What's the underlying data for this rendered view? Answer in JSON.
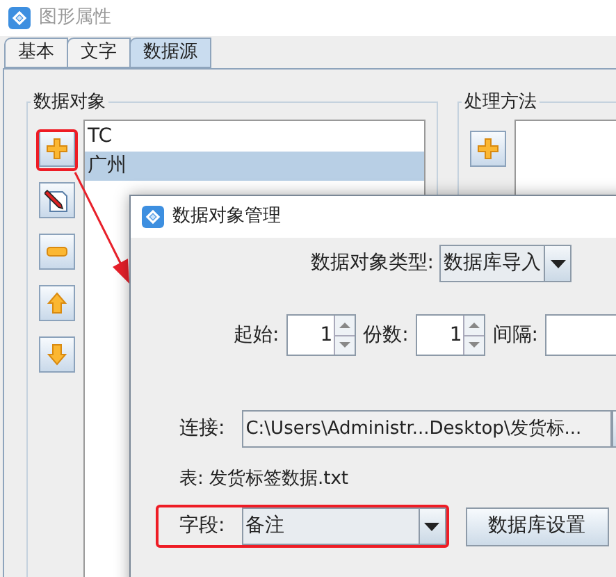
{
  "window": {
    "title": "图形属性"
  },
  "tabs": [
    {
      "label": "基本",
      "selected": false
    },
    {
      "label": "文字",
      "selected": false
    },
    {
      "label": "数据源",
      "selected": true
    }
  ],
  "data_objects": {
    "title": "数据对象",
    "items": [
      {
        "label": "TC",
        "selected": false
      },
      {
        "label": "广州",
        "selected": true
      }
    ]
  },
  "processing": {
    "title": "处理方法"
  },
  "dialog": {
    "title": "数据对象管理",
    "type_label": "数据对象类型:",
    "type_value": "数据库导入",
    "start_label": "起始:",
    "start_value": "1",
    "copies_label": "份数:",
    "copies_value": "1",
    "interval_label": "间隔:",
    "connection_label": "连接:",
    "connection_value": "C:\\Users\\Administr...Desktop\\发货标...",
    "table_text": "表: 发货标签数据.txt",
    "field_label": "字段:",
    "field_value": "备注",
    "db_settings_button": "数据库设置"
  }
}
